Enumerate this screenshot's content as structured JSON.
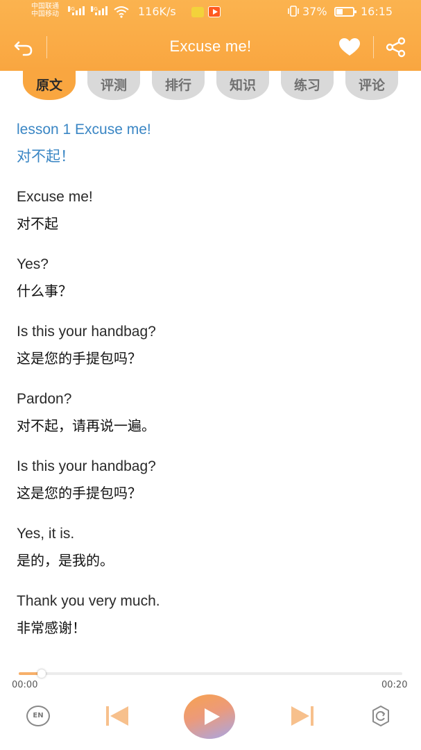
{
  "status_bar": {
    "carrier_1": "中国联通",
    "carrier_2": "中国移动",
    "net_1": "4G",
    "net_2": "4G",
    "speed": "116K/s",
    "battery_percent": "37%",
    "battery_level": 0.37,
    "time": "16:15"
  },
  "header": {
    "title": "Excuse me!",
    "background_color": "#f9a640"
  },
  "tabs": [
    {
      "label": "原文",
      "active": true
    },
    {
      "label": "评测",
      "active": false
    },
    {
      "label": "排行",
      "active": false
    },
    {
      "label": "知识",
      "active": false
    },
    {
      "label": "练习",
      "active": false
    },
    {
      "label": "评论",
      "active": false
    }
  ],
  "lesson": {
    "title_en": "lesson 1 Excuse me!",
    "title_zh": "对不起！",
    "lines": [
      {
        "en": "Excuse me!",
        "zh": "对不起"
      },
      {
        "en": "Yes?",
        "zh": "什么事？"
      },
      {
        "en": "Is this your handbag?",
        "zh": "这是您的手提包吗？"
      },
      {
        "en": "Pardon?",
        "zh": "对不起，请再说一遍。"
      },
      {
        "en": "Is this your handbag?",
        "zh": "这是您的手提包吗？"
      },
      {
        "en": "Yes, it is.",
        "zh": "是的，是我的。"
      },
      {
        "en": "Thank you very much.",
        "zh": "非常感谢！"
      }
    ]
  },
  "player": {
    "current_time": "00:00",
    "total_time": "00:20",
    "progress": 0.06,
    "lang_toggle_label": "EN",
    "icons": {
      "back": "back-arrow-icon",
      "favorite": "heart-icon",
      "share": "share-icon",
      "prev": "skip-previous-icon",
      "play": "play-icon",
      "next": "skip-next-icon",
      "loop": "loop-mode-icon"
    }
  }
}
